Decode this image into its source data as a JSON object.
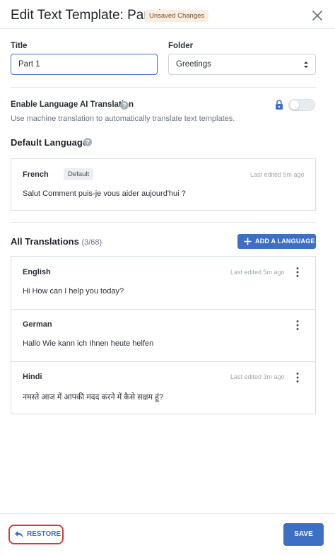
{
  "header": {
    "title": "Edit Text Template: Part 1",
    "badge": "Unsaved Changes"
  },
  "fields": {
    "title_label": "Title",
    "title_value": "Part 1",
    "folder_label": "Folder",
    "folder_value": "Greetings"
  },
  "ai_translation": {
    "label": "Enable Language AI Translation",
    "description": "Use machine translation to automatically translate text templates.",
    "enabled": false
  },
  "default_language": {
    "heading": "Default Language",
    "language": "French",
    "tag": "Default",
    "edited": "Last edited 5m ago",
    "text": "Salut Comment puis-je vous aider aujourd'hui ?"
  },
  "translations": {
    "heading": "All Translations",
    "count": "(3/68)",
    "add_button": "ADD A LANGUAGE",
    "items": [
      {
        "language": "English",
        "edited": "Last edited 5m ago",
        "text": "Hi How can I help you today?"
      },
      {
        "language": "German",
        "edited": "",
        "text": "Hallo Wie kann ich Ihnen heute helfen"
      },
      {
        "language": "Hindi",
        "edited": "Last edited 3m ago",
        "text": "नमस्ते आज में आपकी मदद करने में कैसे सक्षम हूं?"
      }
    ]
  },
  "footer": {
    "restore_label": "RESTORE",
    "save_label": "SAVE"
  },
  "colors": {
    "accent": "#3f6fc2",
    "restore_highlight": "#d63b3b",
    "unsaved_badge_bg": "#fbeee0"
  }
}
